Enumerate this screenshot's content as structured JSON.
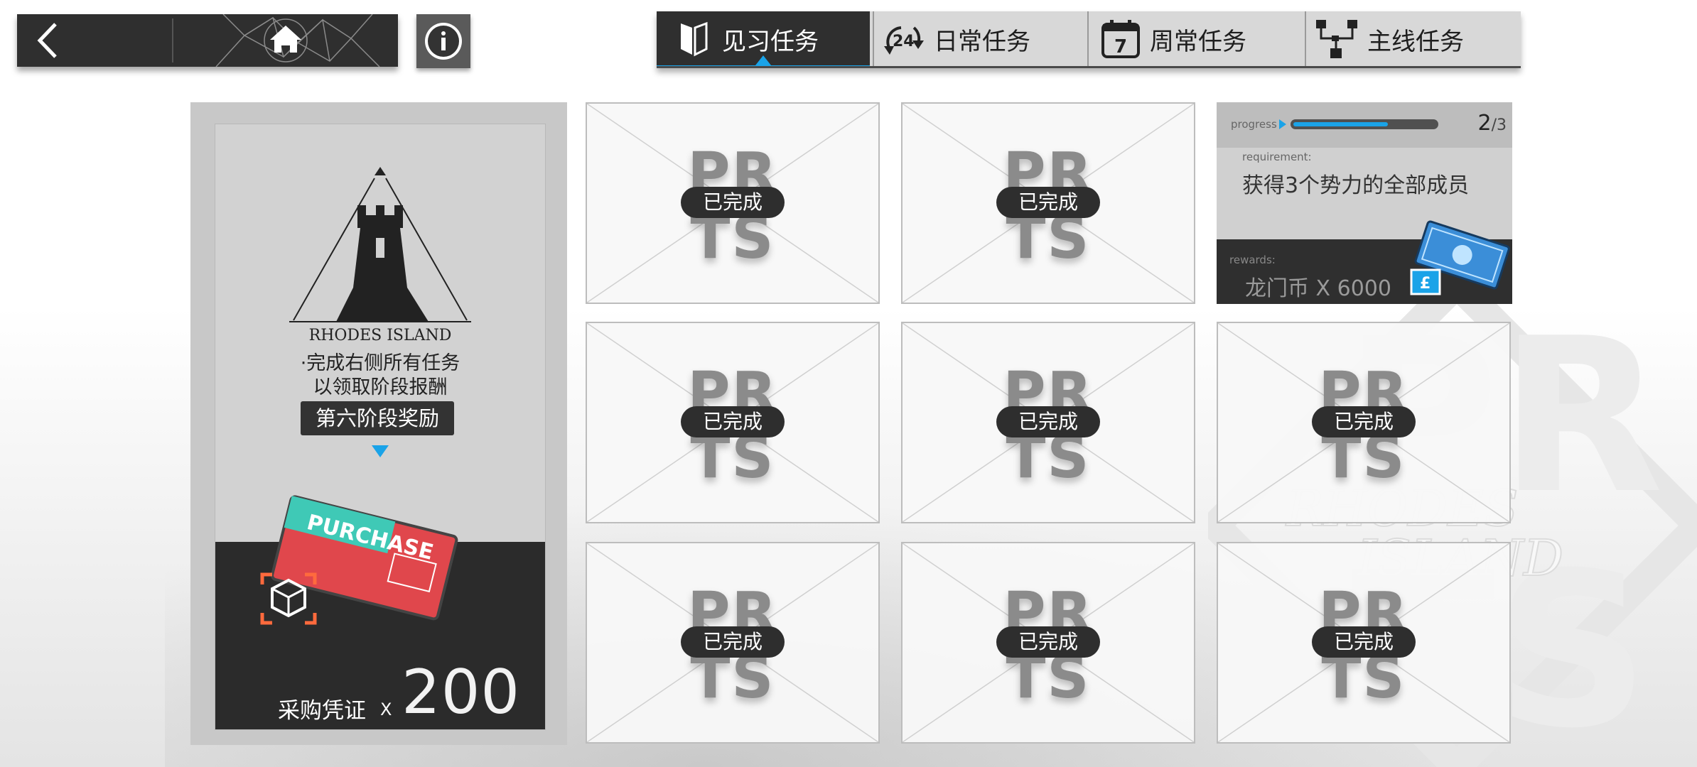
{
  "nav": {
    "back_icon": "chevron-left-icon",
    "home_icon": "home-icon",
    "info_icon": "info-icon"
  },
  "tabs": [
    {
      "label": "见习任务",
      "icon": "trainee-flag-icon",
      "active": true
    },
    {
      "label": "日常任务",
      "icon": "daily-24h-icon",
      "active": false
    },
    {
      "label": "周常任务",
      "icon": "calendar-7-icon",
      "active": false
    },
    {
      "label": "主线任务",
      "icon": "hierarchy-icon",
      "active": false
    }
  ],
  "stage": {
    "logo_text": "RHODES ISLAND",
    "desc_line1": "·完成右侧所有任务",
    "desc_line2": "以领取阶段报酬",
    "badge": "第六阶段奖励",
    "reward_name": "采购凭证",
    "reward_x": "X",
    "reward_count": "200",
    "certificate_text": "PURCHASE"
  },
  "missions": {
    "completed_label": "已完成",
    "logo_line1": "PR",
    "logo_line2": "TS",
    "active": {
      "progress_label": "progress",
      "progress_current": "2",
      "progress_total": "/3",
      "progress_fraction": 0.6667,
      "requirement_label": "requirement:",
      "requirement_text": "获得3个势力的全部成员",
      "rewards_label": "rewards:",
      "rewards_text": "龙门币 X 6000"
    }
  },
  "colors": {
    "accent": "#1aa3e8",
    "dark": "#2f2f2f",
    "reward_red": "#e0474c"
  }
}
